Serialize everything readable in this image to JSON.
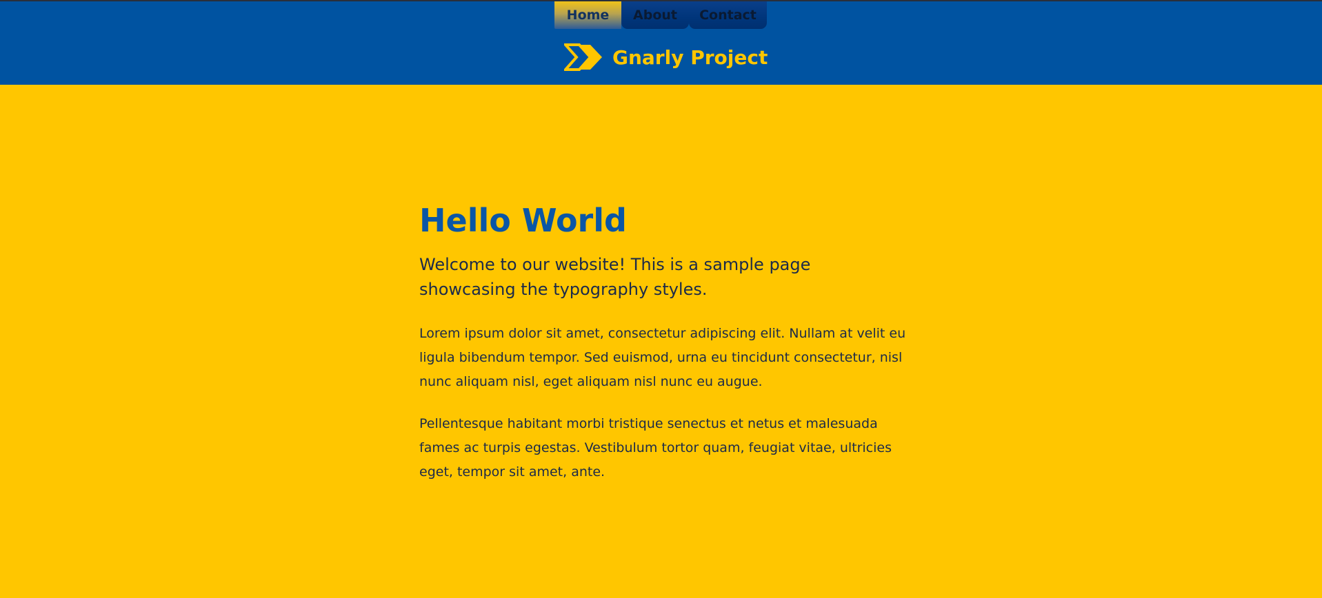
{
  "nav": {
    "items": [
      {
        "label": "Home",
        "active": true
      },
      {
        "label": "About",
        "active": false
      },
      {
        "label": "Contact",
        "active": false
      }
    ]
  },
  "brand": {
    "title": "Gnarly Project",
    "logo_icon": "double-chevron-right-icon"
  },
  "main": {
    "heading": "Hello World",
    "intro": "Welcome to our website! This is a sample page showcasing the typography styles.",
    "paragraphs": [
      "Lorem ipsum dolor sit amet, consectetur adipiscing elit. Nullam at velit eu ligula bibendum tempor. Sed euismod, urna eu tincidunt consectetur, nisl nunc aliquam nisl, eget aliquam nisl nunc eu augue.",
      "Pellentesque habitant morbi tristique senectus et netus et malesuada fames ac turpis egestas. Vestibulum tortor quam, feugiat vitae, ultricies eget, tempor sit amet, ante."
    ]
  },
  "colors": {
    "header_bg": "#0053a1",
    "page_bg": "#ffc600",
    "brand_accent": "#ffc600",
    "heading": "#0a56a6",
    "text": "#1b2a4a"
  }
}
